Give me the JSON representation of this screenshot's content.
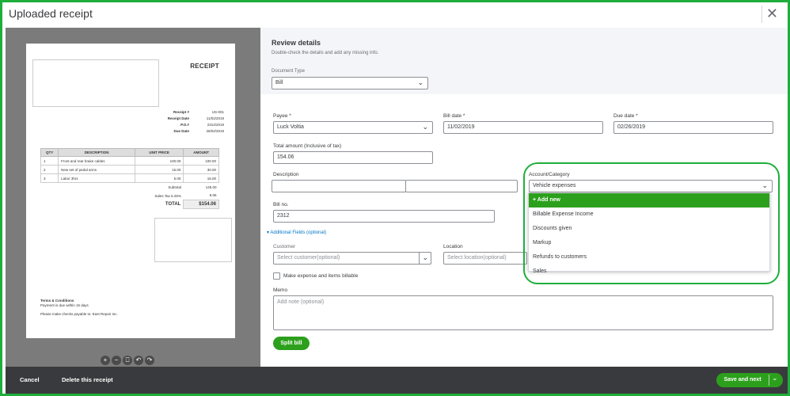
{
  "window": {
    "title": "Uploaded receipt"
  },
  "receipt": {
    "title": "RECEIPT",
    "meta": [
      {
        "label": "Receipt #",
        "value": "US-001"
      },
      {
        "label": "Receipt Date",
        "value": "11/02/2019"
      },
      {
        "label": "P.O.#",
        "value": "2312/2019"
      },
      {
        "label": "Due Date",
        "value": "26/02/2019"
      }
    ],
    "columns": [
      "QTY",
      "DESCRIPTION",
      "UNIT PRICE",
      "AMOUNT"
    ],
    "rows": [
      {
        "qty": "1",
        "desc": "Front and rear brake cables",
        "price": "100.00",
        "amount": "100.00"
      },
      {
        "qty": "2",
        "desc": "New set of pedal arms",
        "price": "15.00",
        "amount": "30.00"
      },
      {
        "qty": "3",
        "desc": "Labor 3hrs",
        "price": "5.00",
        "amount": "15.00"
      }
    ],
    "subtotal_label": "Subtotal",
    "subtotal": "145.00",
    "tax_label": "Sales Tax 6.25%",
    "tax": "9.06",
    "total_label": "TOTAL",
    "total": "$154.06",
    "terms_title": "Terms & Conditions",
    "terms_line1": "Payment is due within 15 days",
    "terms_line2": "Please make checks payable to: East Repair Inc."
  },
  "preview_tools": [
    "+",
    "−",
    "⎕",
    "↶",
    "↷"
  ],
  "review": {
    "heading": "Review details",
    "subtitle": "Double-check the details and add any missing info.",
    "doc_type_label": "Document Type",
    "doc_type_value": "Bill"
  },
  "form": {
    "payee_label": "Payee *",
    "payee_value": "Luck Voltia",
    "bill_date_label": "Bill date *",
    "bill_date_value": "11/02/2019",
    "due_date_label": "Due date *",
    "due_date_value": "02/26/2019",
    "total_label": "Total amount (Inclusive of tax)",
    "total_value": "154.06",
    "description_label": "Description",
    "account_label": "Account/Category",
    "account_value": "Vehicle expenses",
    "bill_no_label": "Bill no.",
    "bill_no_value": "2312",
    "additional_fields": "Additional Fields (optional)",
    "customer_label": "Customer",
    "customer_placeholder": "Select customer(optional)",
    "location_label": "Location",
    "location_placeholder": "Select location(optional)",
    "billable_label": "Make expense and items billable",
    "memo_label": "Memo",
    "memo_placeholder": "Add note (optional)",
    "split_bill": "Split bill"
  },
  "dropdown": {
    "add_new": "Add new",
    "items": [
      "Billable Expense Income",
      "Discounts given",
      "Markup",
      "Refunds to customers",
      "Sales"
    ]
  },
  "footer": {
    "cancel": "Cancel",
    "delete": "Delete this receipt",
    "save": "Save and next"
  },
  "colors": {
    "accent_green": "#2ca01c",
    "frame_green": "#1fae3c",
    "link_blue": "#0077c5"
  }
}
